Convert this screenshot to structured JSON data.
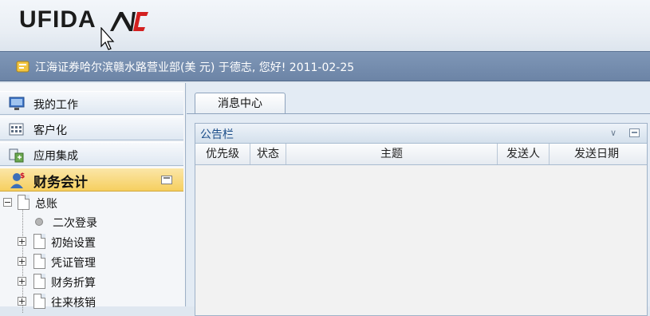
{
  "brand": {
    "name": "UFIDA",
    "product_mark": "NC"
  },
  "status": {
    "text": "江海证券哈尔滨赣水路营业部(美 元) 于德志, 您好! 2011-02-25"
  },
  "sidebar": {
    "items": [
      {
        "label": "我的工作",
        "icon": "my-work-icon"
      },
      {
        "label": "客户化",
        "icon": "customize-icon"
      },
      {
        "label": "应用集成",
        "icon": "integration-icon"
      },
      {
        "label": "财务会计",
        "icon": "finance-icon",
        "active": true
      }
    ],
    "tree": {
      "root": "总账",
      "children": [
        "二次登录",
        "初始设置",
        "凭证管理",
        "财务折算",
        "往来核销"
      ]
    }
  },
  "main": {
    "tab": "消息中心",
    "panel": {
      "title": "公告栏",
      "columns": [
        "优先级",
        "状态",
        "主题",
        "发送人",
        "发送日期"
      ]
    }
  },
  "colors": {
    "status_bar": "#7289ab",
    "active_nav": "#f6cf5f",
    "panel_title": "#1d4f8a"
  }
}
